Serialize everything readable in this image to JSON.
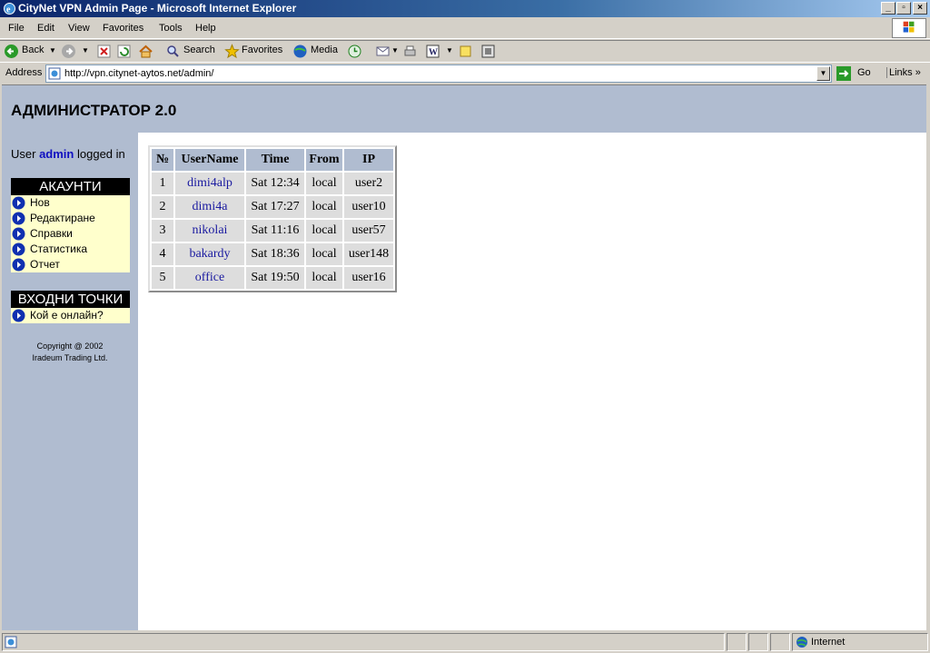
{
  "window": {
    "title": "CityNet VPN Admin Page - Microsoft Internet Explorer",
    "minimize": "_",
    "maximize": "▫",
    "close": "×"
  },
  "menubar": {
    "items": [
      {
        "label": "File"
      },
      {
        "label": "Edit"
      },
      {
        "label": "View"
      },
      {
        "label": "Favorites"
      },
      {
        "label": "Tools"
      },
      {
        "label": "Help"
      }
    ]
  },
  "toolbar": {
    "back": "Back",
    "search": "Search",
    "favorites": "Favorites",
    "media": "Media"
  },
  "addressbar": {
    "label": "Address",
    "url": "http://vpn.citynet-aytos.net/admin/",
    "go": "Go",
    "links": "Links"
  },
  "page": {
    "header_title": "АДМИНИСТРАТОР 2.0",
    "login": {
      "prefix": "User",
      "user": "admin",
      "suffix": "logged in"
    },
    "sections": [
      {
        "title": "АКАУНТИ",
        "items": [
          "Нов",
          "Редактиране",
          "Справки",
          "Статистика",
          "Отчет"
        ]
      },
      {
        "title": "ВХОДНИ ТОЧКИ",
        "items": [
          "Кой е онлайн?"
        ]
      }
    ],
    "copyright": [
      "Copyright @ 2002",
      "Iradeum Trading Ltd."
    ],
    "table": {
      "columns": [
        "№",
        "UserName",
        "Time",
        "From",
        "IP"
      ],
      "rows": [
        [
          "1",
          "dimi4alp",
          "Sat 12:34",
          "local",
          "user2"
        ],
        [
          "2",
          "dimi4a",
          "Sat 17:27",
          "local",
          "user10"
        ],
        [
          "3",
          "nikolai",
          "Sat 11:16",
          "local",
          "user57"
        ],
        [
          "4",
          "bakardy",
          "Sat 18:36",
          "local",
          "user148"
        ],
        [
          "5",
          "office",
          "Sat 19:50",
          "local",
          "user16"
        ]
      ]
    }
  },
  "statusbar": {
    "zone": "Internet"
  },
  "colors": {
    "sidebar_bg": "#b0bcd0",
    "section_body": "#ffffcc",
    "link": "#1a1aa0"
  }
}
